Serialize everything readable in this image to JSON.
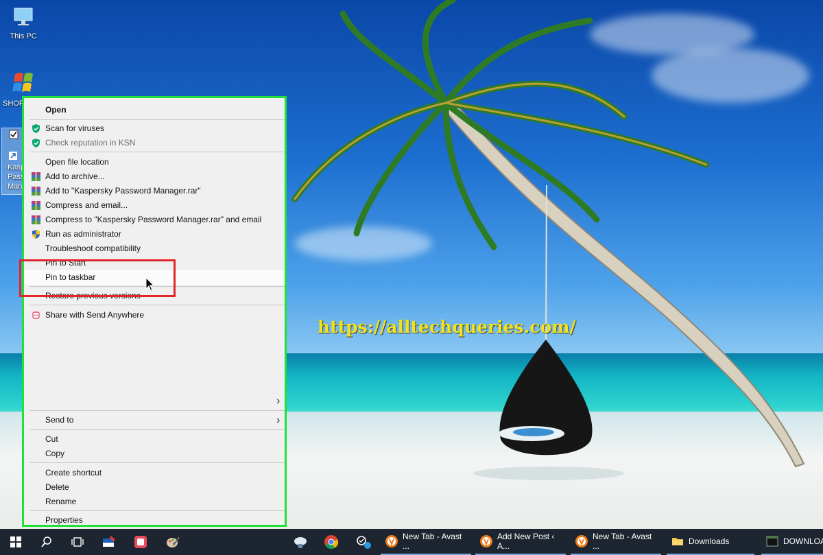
{
  "desktop": {
    "icons": [
      {
        "label": "This PC",
        "icon": "monitor-icon"
      },
      {
        "label": "SHOP",
        "icon": "windows-flag-icon"
      },
      {
        "label_lines": [
          "Kasp",
          "Pass",
          "Man"
        ],
        "icon": "shortcut-icon"
      }
    ],
    "watermark": "https://alltechqueries.com/"
  },
  "context_menu": {
    "accent_border": "#22e03a",
    "highlight_color": "#e0262a",
    "items": [
      {
        "label": "Open",
        "style": "bold"
      },
      {
        "label": "Scan for viruses",
        "icon": "kaspersky-shield-icon"
      },
      {
        "label": "Check reputation in KSN",
        "icon": "kaspersky-shield-icon",
        "disabled": true
      },
      {
        "label": "Open file location"
      },
      {
        "label": "Add to archive...",
        "icon": "winrar-icon"
      },
      {
        "label": "Add to \"Kaspersky Password Manager.rar\"",
        "icon": "winrar-icon"
      },
      {
        "label": "Compress and email...",
        "icon": "winrar-icon"
      },
      {
        "label": "Compress to \"Kaspersky Password Manager.rar\" and email",
        "icon": "winrar-icon"
      },
      {
        "label": "Run as administrator",
        "icon": "uac-shield-icon"
      },
      {
        "label": "Troubleshoot compatibility"
      },
      {
        "label": "Pin to Start"
      },
      {
        "label": "Pin to taskbar",
        "hovered": true
      },
      {
        "label": "Restore previous versions"
      },
      {
        "label": "Share with Send Anywhere",
        "icon": "send-anywhere-icon"
      },
      {
        "label": "Send to",
        "submenu": true
      },
      {
        "label": "Cut"
      },
      {
        "label": "Copy"
      },
      {
        "label": "Create shortcut"
      },
      {
        "label": "Delete"
      },
      {
        "label": "Rename"
      },
      {
        "label": "Properties"
      }
    ]
  },
  "taskbar": {
    "pinned_icons": [
      "windows-start-icon",
      "search-icon",
      "task-view-icon",
      "paint-app-icon",
      "snip-app-icon",
      "paint-brush-icon",
      "cloud-app-icon",
      "chrome-icon",
      "tools-app-icon"
    ],
    "tasks": [
      {
        "label": "New Tab - Avast ...",
        "icon": "avast-browser-icon"
      },
      {
        "label": "Add New Post ‹ A...",
        "icon": "avast-browser-icon"
      },
      {
        "label": "New Tab - Avast ...",
        "icon": "avast-browser-icon"
      },
      {
        "label": "Downloads",
        "icon": "folder-icon"
      },
      {
        "label": "DOWNLOAD",
        "icon": "terminal-icon"
      }
    ]
  }
}
